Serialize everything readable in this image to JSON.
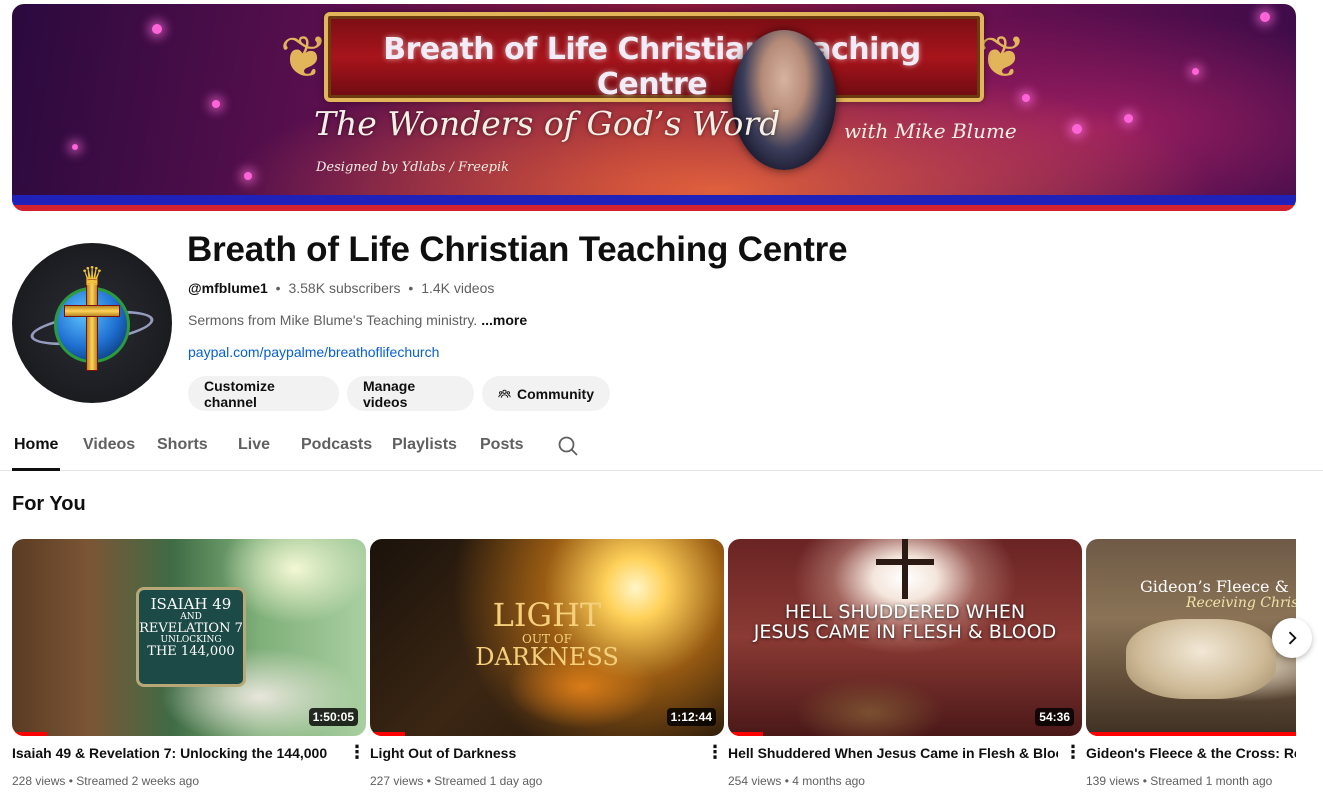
{
  "banner": {
    "title": "Breath of Life Christian Teaching Centre",
    "subtitle": "The Wonders of God’s Word",
    "byline": "with Mike Blume",
    "credit": "Designed by Ydlabs / Freepik"
  },
  "channel": {
    "name": "Breath of Life Christian Teaching Centre",
    "handle": "@mfblume1",
    "subscribers": "3.58K subscribers",
    "videos": "1.4K videos",
    "separator": "•",
    "description": "Sermons from Mike Blume's Teaching ministry.",
    "more_label": "...more",
    "link": "paypal.com/paypalme/breathoflifechurch"
  },
  "actions": {
    "customize": "Customize channel",
    "manage": "Manage videos",
    "community": "Community"
  },
  "tabs": [
    {
      "label": "Home",
      "active": true
    },
    {
      "label": "Videos"
    },
    {
      "label": "Shorts"
    },
    {
      "label": "Live"
    },
    {
      "label": "Podcasts"
    },
    {
      "label": "Playlists"
    },
    {
      "label": "Posts"
    }
  ],
  "section": {
    "title": "For You"
  },
  "videos": [
    {
      "title": "Isaiah 49 & Revelation 7: Unlocking the 144,000",
      "views": "228 views",
      "age": "Streamed 2 weeks ago",
      "duration": "1:50:05",
      "progress": 0.1,
      "thumb_lines": [
        "ISAIAH 49",
        "AND",
        "REVELATION 7",
        "UNLOCKING",
        "THE 144,000"
      ]
    },
    {
      "title": "Light Out of Darkness",
      "views": "227 views",
      "age": "Streamed 1 day ago",
      "duration": "1:12:44",
      "progress": 0.1,
      "thumb_lines": [
        "LIGHT",
        "OUT OF",
        "DARKNESS"
      ]
    },
    {
      "title": "Hell Shuddered When Jesus Came in Flesh & Blood",
      "views": "254 views",
      "age": "4 months ago",
      "duration": "54:36",
      "progress": 0.1,
      "thumb_lines": [
        "HELL SHUDDERED WHEN",
        "JESUS CAME IN FLESH & BLOOD"
      ]
    },
    {
      "title": "Gideon's Fleece & the Cross: Rece",
      "views": "139 views",
      "age": "Streamed 1 month ago",
      "progress": 1.0,
      "thumb_lines": [
        "Gideon’s Fleece &",
        "Receiving Christ"
      ]
    }
  ],
  "icons": {
    "search": "search-icon",
    "community": "community-icon",
    "menu": "more-vert-icon",
    "next": "chevron-right-icon"
  },
  "colors": {
    "link": "#065fd4",
    "progress": "#ff0000",
    "pill_bg": "#f2f2f2"
  }
}
